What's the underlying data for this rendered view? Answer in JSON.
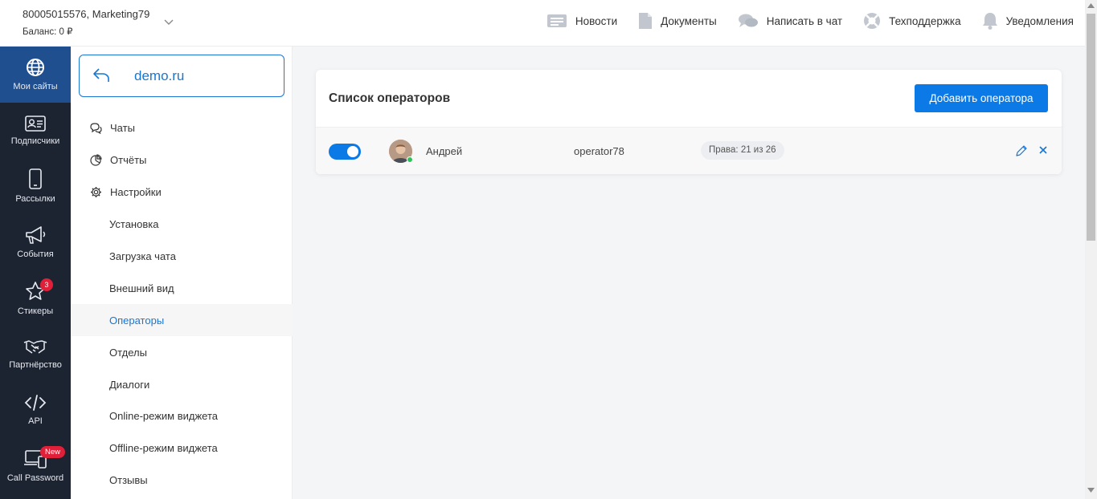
{
  "header": {
    "account_phone": "80005015576",
    "account_name": ", Marketing79",
    "balance": "Баланс: 0 ₽",
    "nav": [
      {
        "label": "Новости",
        "icon": "news-icon"
      },
      {
        "label": "Документы",
        "icon": "document-icon"
      },
      {
        "label": "Написать в чат",
        "icon": "chat-bubbles-icon"
      },
      {
        "label": "Техподдержка",
        "icon": "lifebuoy-icon"
      },
      {
        "label": "Уведомления",
        "icon": "bell-icon"
      }
    ]
  },
  "sidebar": {
    "items": [
      {
        "label": "Мои сайты",
        "icon": "globe-icon"
      },
      {
        "label": "Подписчики",
        "icon": "id-card-icon"
      },
      {
        "label": "Рассылки",
        "icon": "phone-icon"
      },
      {
        "label": "События",
        "icon": "megaphone-icon"
      },
      {
        "label": "Стикеры",
        "icon": "star-icon",
        "badge": "3"
      },
      {
        "label": "Партнёрство",
        "icon": "handshake-icon"
      },
      {
        "label": "API",
        "icon": "code-icon"
      },
      {
        "label": "Call Password",
        "icon": "devices-icon",
        "badge": "New"
      }
    ]
  },
  "submenu": {
    "site": "demo.ru",
    "items": [
      {
        "label": "Чаты",
        "icon": "chats-icon"
      },
      {
        "label": "Отчёты",
        "icon": "pie-chart-icon"
      },
      {
        "label": "Настройки",
        "icon": "gear-icon"
      },
      {
        "label": "Установка"
      },
      {
        "label": "Загрузка чата"
      },
      {
        "label": "Внешний вид"
      },
      {
        "label": "Операторы"
      },
      {
        "label": "Отделы"
      },
      {
        "label": "Диалоги"
      },
      {
        "label": "Online-режим виджета"
      },
      {
        "label": "Offline-режим виджета"
      },
      {
        "label": "Отзывы"
      }
    ]
  },
  "main": {
    "title": "Список операторов",
    "add_button": "Добавить оператора",
    "operators": [
      {
        "name": "Андрей",
        "login": "operator78",
        "rights": "Права: 21 из 26",
        "enabled": true,
        "online": true
      }
    ]
  },
  "colors": {
    "accent": "#0b7ae6",
    "sidebar_bg": "#1c2331",
    "sidebar_active": "#1f4f8f",
    "badge": "#e02039",
    "online": "#2ec25b"
  }
}
